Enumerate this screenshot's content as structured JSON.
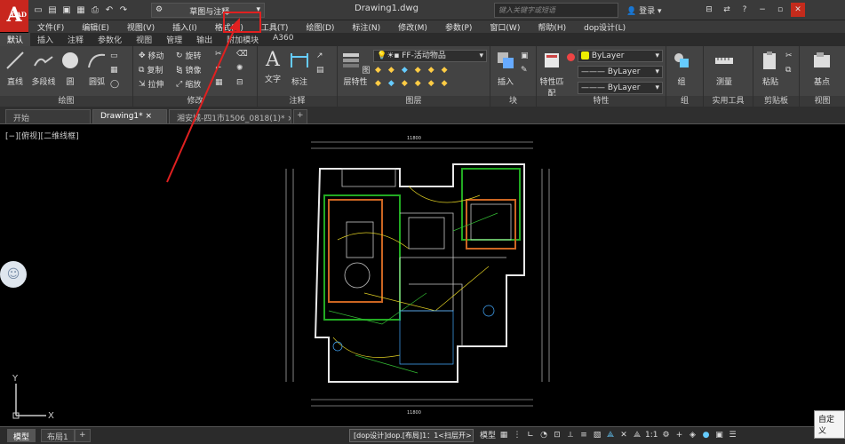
{
  "app": {
    "logo_letter": "A",
    "logo_sub": "CAD"
  },
  "quick_access": {
    "icons": [
      "new-icon",
      "open-icon",
      "save-icon",
      "save-as-icon",
      "print-icon",
      "undo-icon",
      "redo-icon"
    ]
  },
  "workspace": {
    "label": "草图与注释"
  },
  "window": {
    "title": "Drawing1.dwg",
    "search_placeholder": "键入关键字或短语",
    "login": "登录"
  },
  "menu": {
    "items": [
      "文件(F)",
      "编辑(E)",
      "视图(V)",
      "插入(I)",
      "格式(O)",
      "工具(T)",
      "绘图(D)",
      "标注(N)",
      "修改(M)",
      "参数(P)",
      "窗口(W)",
      "帮助(H)",
      "dop设计(L)"
    ]
  },
  "ribbon_tabs": {
    "items": [
      "默认",
      "插入",
      "注释",
      "参数化",
      "视图",
      "管理",
      "输出",
      "附加模块",
      "A360"
    ]
  },
  "ribbon": {
    "draw": {
      "title": "绘图",
      "line": "直线",
      "polyline": "多段线",
      "circle": "圆",
      "arc": "圆弧"
    },
    "modify": {
      "title": "修改",
      "move": "移动",
      "rotate": "旋转",
      "copy": "复制",
      "mirror": "镜像",
      "stretch": "拉伸",
      "scale": "缩放"
    },
    "annotation": {
      "title": "注释",
      "text": "文字",
      "dimension": "标注"
    },
    "layers": {
      "title": "图层",
      "props": "图层特性",
      "current_layer": "FF-活动物品"
    },
    "block": {
      "title": "块",
      "insert": "插入"
    },
    "properties": {
      "title": "特性",
      "match": "特性匹配",
      "color": "ByLayer",
      "linetype": "ByLayer",
      "lineweight": "ByLayer"
    },
    "groups": {
      "title": "组",
      "group": "组"
    },
    "utilities": {
      "title": "实用工具",
      "measure": "测量"
    },
    "clipboard": {
      "title": "剪贴板",
      "paste": "粘贴"
    },
    "view": {
      "title": "视图",
      "base": "基点"
    }
  },
  "doc_tabs": {
    "start": "开始",
    "drawing": "Drawing1*",
    "other": "湘安城-四1市1506_0818(1)*"
  },
  "viewport_label": "[−][俯视][二维线框]",
  "status": {
    "model_tab": "模型",
    "layout_tab": "布局1",
    "command": "[dop设计]dop.[布局]1：1<扫层开>",
    "model_label": "模型",
    "scale": "1:1",
    "tooltip": "自定义"
  },
  "drawing": {
    "top_dim": "11800",
    "bottom_dim": "11800"
  },
  "ucs": {
    "x": "X",
    "y": "Y"
  },
  "colors": {
    "highlight": "#e02020",
    "arrow": "#e02020"
  }
}
